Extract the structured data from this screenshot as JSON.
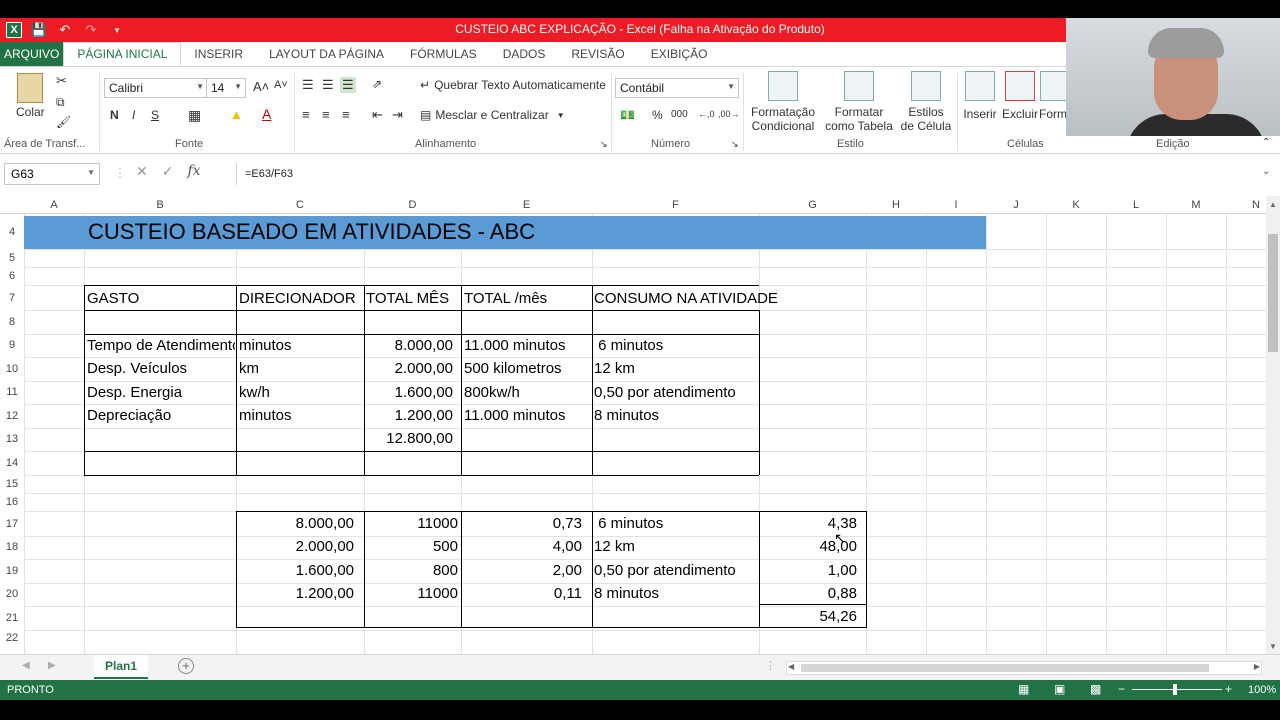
{
  "window": {
    "title": "CUSTEIO ABC EXPLICAÇÃO -  Excel (Falha na Ativação do Produto)"
  },
  "ribbon_tabs": [
    "ARQUIVO",
    "PÁGINA INICIAL",
    "INSERIR",
    "LAYOUT DA PÁGINA",
    "FÓRMULAS",
    "DADOS",
    "REVISÃO",
    "EXIBIÇÃO"
  ],
  "ribbon": {
    "paste_label": "Colar",
    "font_name": "Calibri",
    "font_size": "14",
    "bold": "N",
    "italic": "I",
    "underline": "S",
    "wrap_text": "Quebrar Texto Automaticamente",
    "merge_center": "Mesclar e Centralizar",
    "number_format": "Contábil",
    "percent": "%",
    "thousands": "000",
    "cond_format": "Formatação Condicional",
    "format_table": "Formatar como Tabela",
    "cell_styles": "Estilos de Célula",
    "insert": "Inserir",
    "delete": "Excluir",
    "format": "Form",
    "groups": {
      "clipboard": "Área de Transf...",
      "font": "Fonte",
      "alignment": "Alinhamento",
      "number": "Número",
      "style": "Estilo",
      "cells": "Células",
      "editing": "Edição"
    }
  },
  "formula_bar": {
    "name_box": "G63",
    "formula": "=E63/F63"
  },
  "columns": [
    "A",
    "B",
    "C",
    "D",
    "E",
    "F",
    "G",
    "H",
    "I",
    "J",
    "K",
    "L",
    "M",
    "N"
  ],
  "rows": [
    "4",
    "5",
    "6",
    "7",
    "8",
    "9",
    "10",
    "11",
    "12",
    "13",
    "14",
    "15",
    "16",
    "17",
    "18",
    "19",
    "20",
    "21",
    "22"
  ],
  "banner": "CUSTEIO BASEADO EM ATIVIDADES - ABC",
  "table1": {
    "headers": [
      "GASTO",
      "DIRECIONADOR",
      "TOTAL MÊS",
      "TOTAL /mês",
      "CONSUMO NA ATIVIDADE"
    ],
    "rows": [
      [
        "Tempo de Atendimento",
        "minutos",
        "8.000,00",
        "11.000 minutos",
        " 6 minutos"
      ],
      [
        "Desp. Veículos",
        "km",
        "2.000,00",
        "500 kilometros",
        "12 km"
      ],
      [
        "Desp. Energia",
        "kw/h",
        "1.600,00",
        "800kw/h",
        "0,50 por atendimento"
      ],
      [
        "Depreciação",
        "minutos",
        "1.200,00",
        "11.000 minutos",
        "8 minutos"
      ]
    ],
    "total": "12.800,00"
  },
  "table2": {
    "rows": [
      [
        "8.000,00",
        "11000",
        "0,73",
        " 6 minutos",
        "4,38"
      ],
      [
        "2.000,00",
        "500",
        "4,00",
        "12 km",
        "48,00"
      ],
      [
        "1.600,00",
        "800",
        "2,00",
        "0,50 por atendimento",
        "1,00"
      ],
      [
        "1.200,00",
        "11000",
        "0,11",
        "8 minutos",
        "0,88"
      ]
    ],
    "total": "54,26"
  },
  "sheet_tab": "Plan1",
  "status": {
    "ready": "PRONTO",
    "zoom": "100%"
  },
  "colors": {
    "excel_green": "#217346",
    "title_red": "#ed1c24",
    "banner_blue": "#5b9bd5"
  }
}
